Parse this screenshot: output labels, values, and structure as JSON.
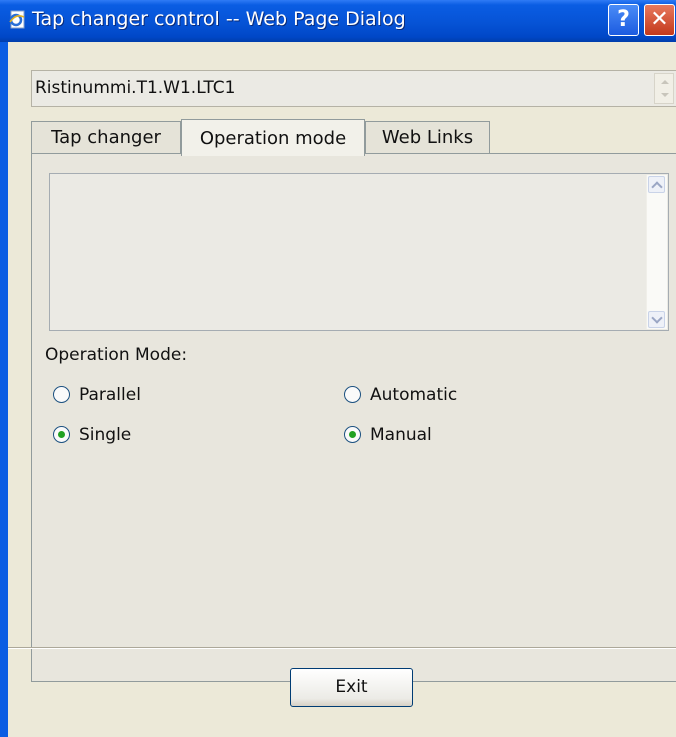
{
  "window": {
    "title": "Tap changer control -- Web Page Dialog",
    "help_glyph": "?",
    "close_glyph": "✕"
  },
  "object_field": {
    "value": "Ristinummi.T1.W1.LTC1"
  },
  "tabs": [
    {
      "label": "Tap changer",
      "active": false
    },
    {
      "label": "Operation mode",
      "active": true
    },
    {
      "label": "Web Links",
      "active": false
    }
  ],
  "operation_mode": {
    "label": "Operation Mode:",
    "options": [
      {
        "label": "Parallel",
        "checked": false
      },
      {
        "label": "Automatic",
        "checked": false
      },
      {
        "label": "Single",
        "checked": true
      },
      {
        "label": "Manual",
        "checked": true
      }
    ]
  },
  "footer": {
    "exit_label": "Exit"
  },
  "icons": {
    "window_icon": "ie-page-icon",
    "help": "help-icon",
    "close": "close-icon"
  },
  "colors": {
    "titlebar": "#0653d6",
    "radio_dot": "#21a121",
    "background": "#ece9d8"
  }
}
